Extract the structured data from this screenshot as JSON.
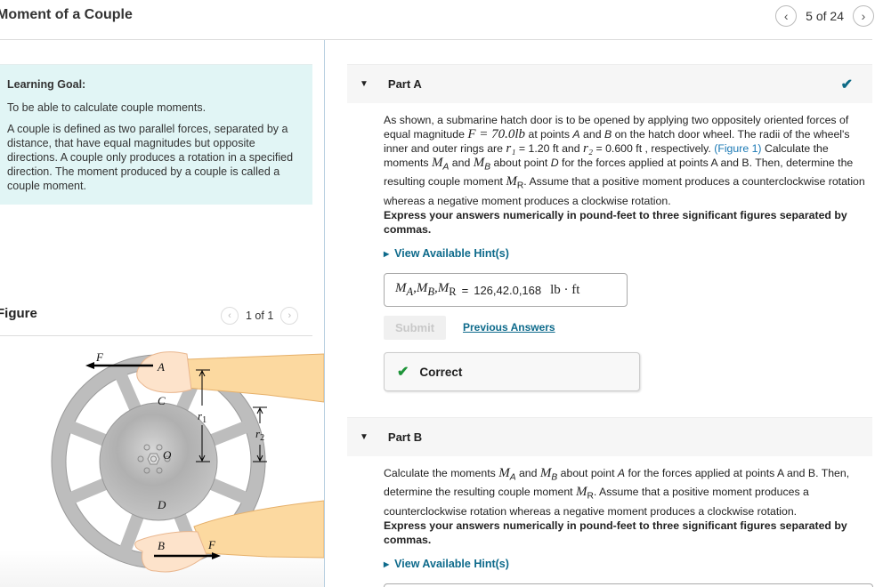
{
  "header": {
    "title": "Moment of a Couple",
    "pager": {
      "label": "5 of 24",
      "prev_icon": "‹",
      "next_icon": "›"
    }
  },
  "learning_goal": {
    "heading": "Learning Goal:",
    "paragraphs": [
      "To be able to calculate couple moments.",
      "A couple is defined as two parallel forces, separated by a distance, that have equal magnitudes but opposite directions. A couple only produces a rotation in a specified direction. The moment produced by a couple is called a couple moment."
    ]
  },
  "figure": {
    "heading": "Figure",
    "pager": {
      "label": "1 of 1",
      "prev_icon": "‹",
      "next_icon": "›"
    },
    "labels": {
      "force_top": "F",
      "force_bottom": "F",
      "point_a": "A",
      "point_b": "B",
      "point_c": "C",
      "point_d": "D",
      "center": "O",
      "r1": "r",
      "r1_sub": "1",
      "r2": "r",
      "r2_sub": "2"
    },
    "colors": {
      "wheel": "#c6c6c6",
      "hub_dark": "#a8a8a8",
      "hand": "#fde3cb",
      "sleeve": "#fcd9a0"
    }
  },
  "part_a": {
    "title": "Part A",
    "status_icon": "✔",
    "text_1": "As shown, a submarine hatch door is to be opened by applying two oppositely oriented forces of equal magnitude ",
    "F_expr": "F = 70.0lb",
    "text_2": " at points ",
    "text_A": "A",
    "text_and": " and ",
    "text_B": "B",
    "text_3": " on the hatch door wheel. The radii of the wheel's inner and outer rings are ",
    "r1_expr": "r₁",
    "r1_val": " = 1.20 ft and ",
    "r2_expr": "r₂",
    "r2_val": " = 0.600 ft , respectively. ",
    "figure_link": "(Figure 1)",
    "text_4": " Calculate the moments ",
    "MA": "M",
    "MA_sub": "A",
    "text_5": " and ",
    "MB": "M",
    "MB_sub": "B",
    "text_6": " about point ",
    "text_D": "D",
    "text_7": " for the forces applied at points A and B. Then, determine the resulting couple moment ",
    "MR": "M",
    "MR_sub": "R",
    "text_8": ". Assume that a positive moment produces a counterclockwise rotation whereas a negative moment produces a clockwise rotation.",
    "instructions": "Express your answers numerically in pound-feet to three significant figures separated by commas.",
    "hint_label": "View Available Hint(s)",
    "answer": {
      "lhs": "M_A,M_B,M_R =",
      "value": "126,42.0,168",
      "unit": "lb · ft"
    },
    "submit_label": "Submit",
    "previous_answers_label": "Previous Answers",
    "feedback": "Correct",
    "colors": {
      "check": "#0e6b86",
      "correct": "#1e9439",
      "link": "#0d6a8b"
    }
  },
  "part_b": {
    "title": "Part B",
    "text_1": "Calculate the moments ",
    "MA": "M",
    "MA_sub": "A",
    "text_2": " and ",
    "MB": "M",
    "MB_sub": "B",
    "text_3": " about point ",
    "text_A": "A",
    "text_4": " for the forces applied at points A and B. Then, determine the resulting couple moment ",
    "MR": "M",
    "MR_sub": "R",
    "text_5": ". Assume that a positive moment produces a counterclockwise rotation whereas a negative moment produces a clockwise rotation.",
    "instructions": "Express your answers numerically in pound-feet to three significant figures separated by commas.",
    "hint_label": "View Available Hint(s)"
  }
}
